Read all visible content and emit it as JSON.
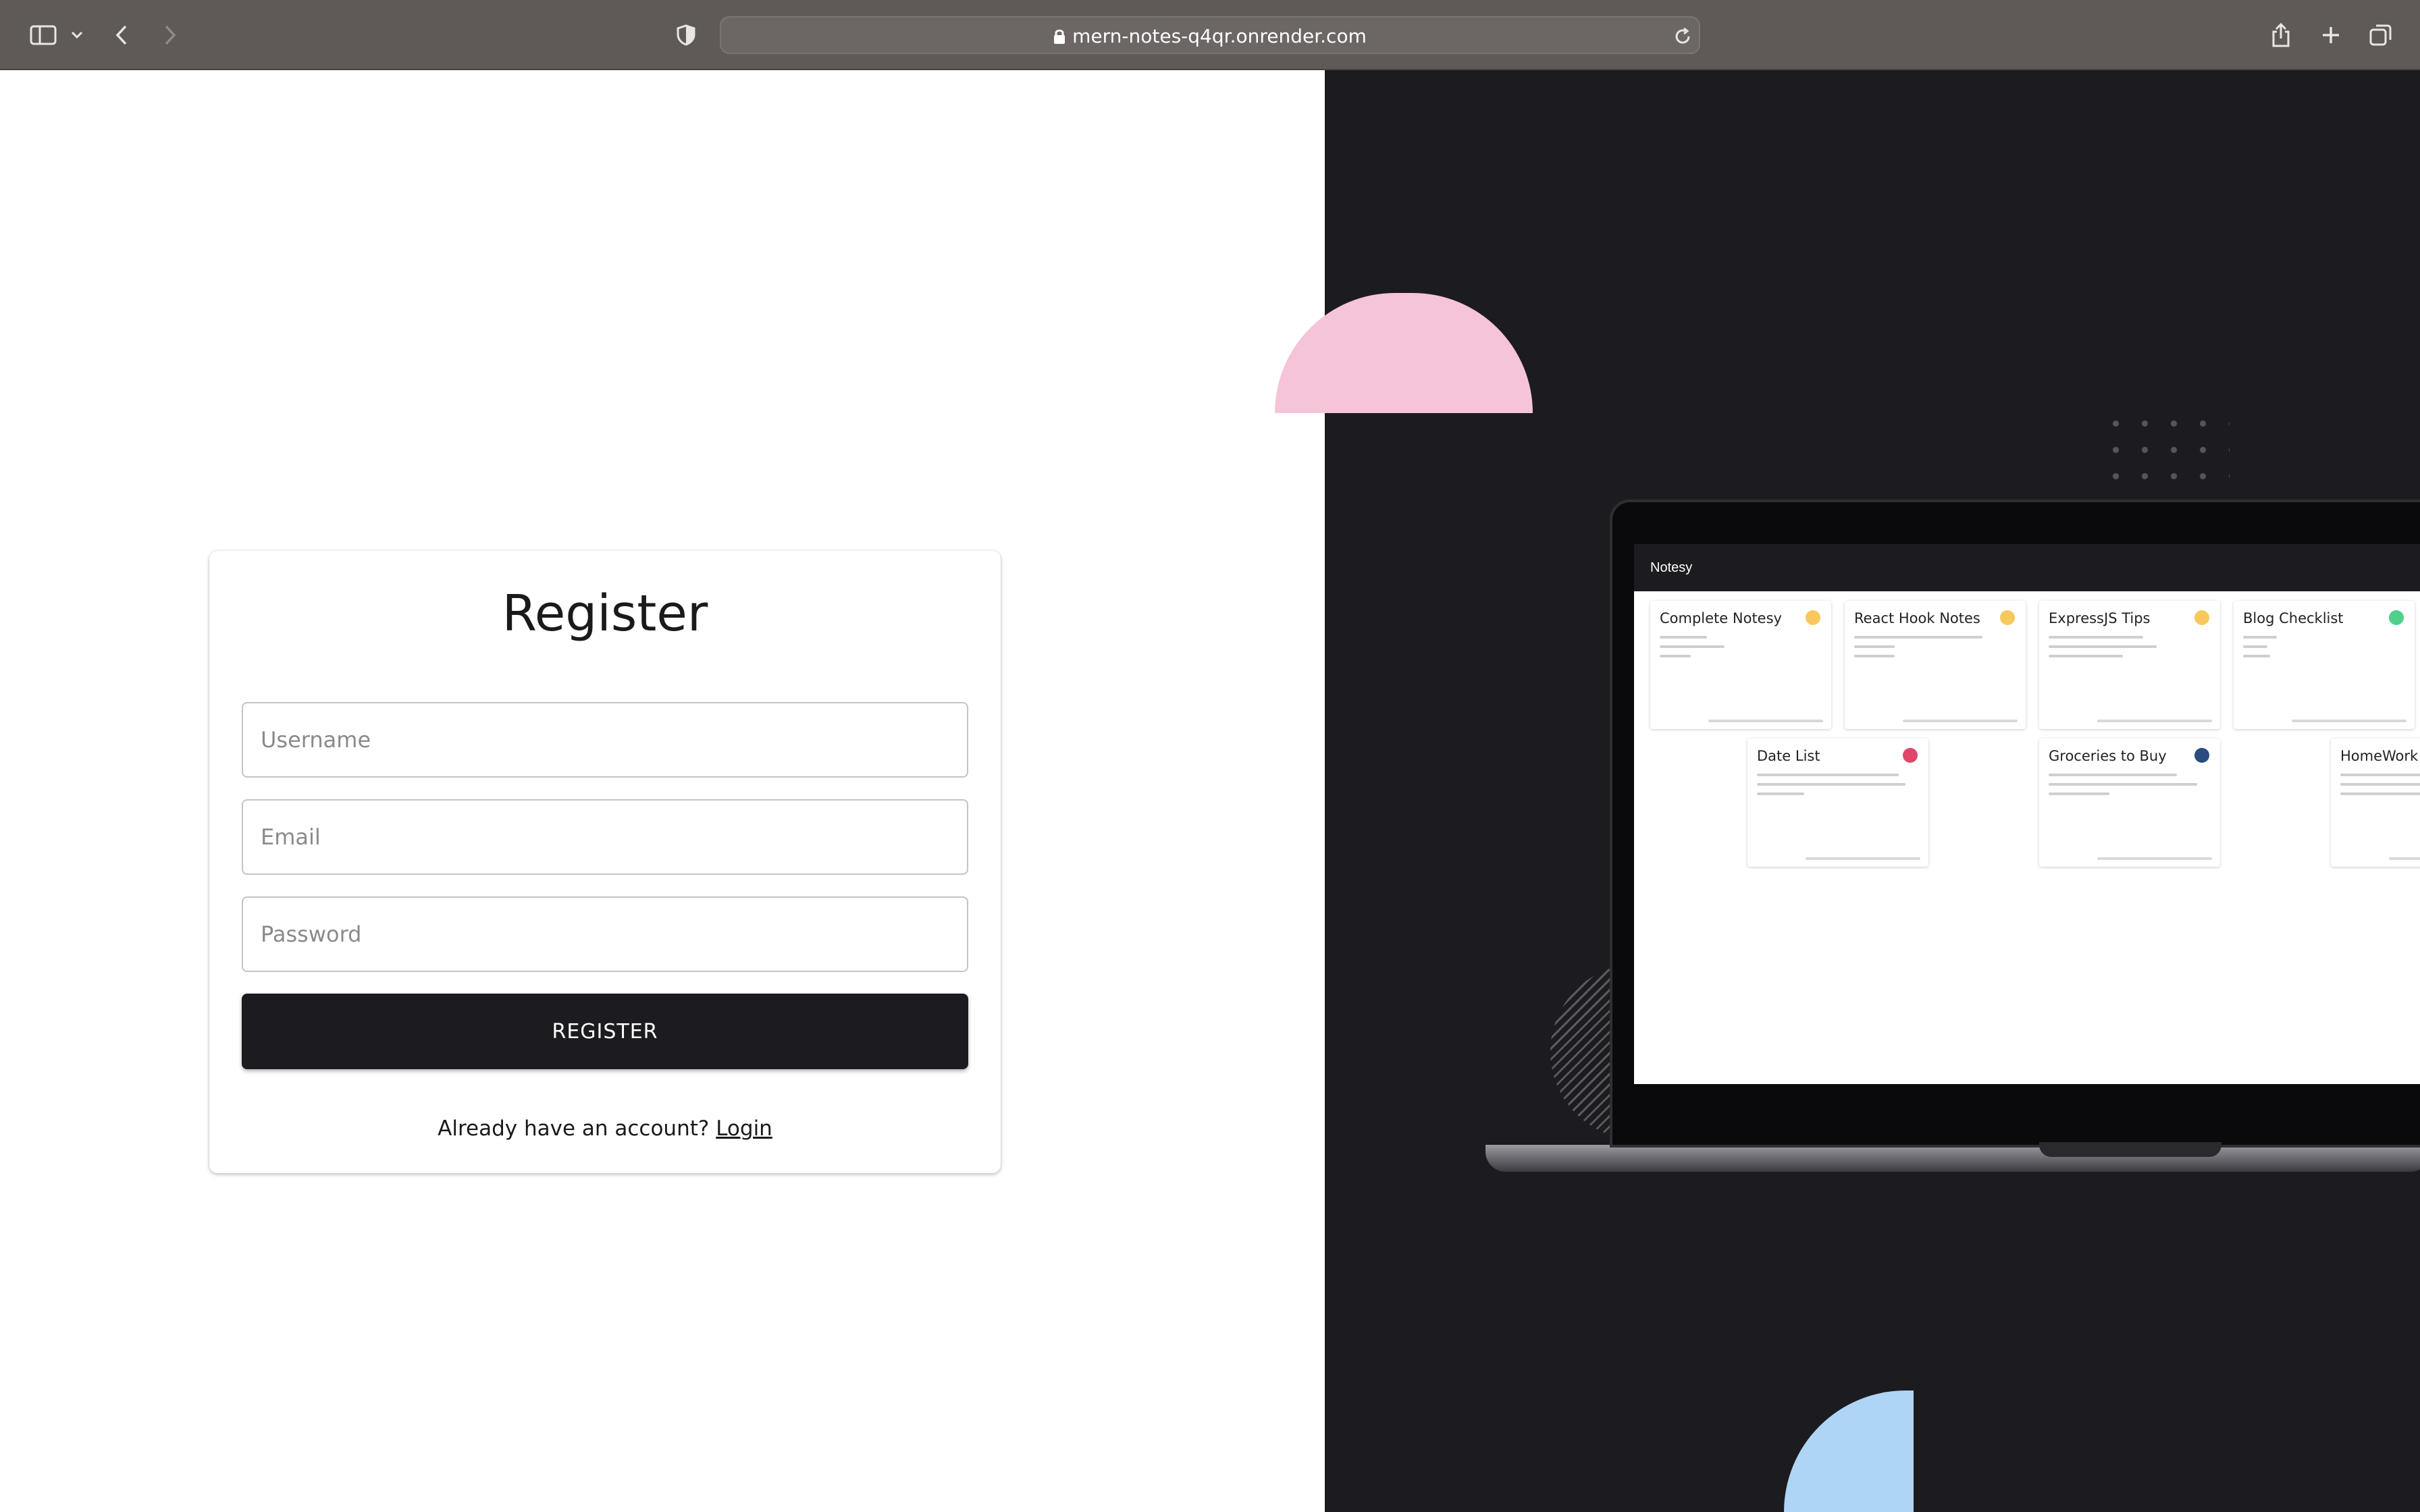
{
  "browser": {
    "url": "mern-notes-q4qr.onrender.com",
    "icons": [
      "sidebar-icon",
      "chevron-down-icon",
      "back-icon",
      "forward-icon",
      "shield-icon",
      "lock-icon",
      "reload-icon",
      "share-icon",
      "new-tab-icon",
      "tabs-overview-icon"
    ]
  },
  "register": {
    "title": "Register",
    "username_placeholder": "Username",
    "email_placeholder": "Email",
    "password_placeholder": "Password",
    "button_label": "REGISTER",
    "already_text": "Already have an account?",
    "login_link": "Login"
  },
  "preview": {
    "app_name": "Notesy",
    "notes": [
      {
        "title": "Complete Notesy",
        "color": "#f7c95c"
      },
      {
        "title": "React Hook Notes",
        "color": "#f7c95c"
      },
      {
        "title": "ExpressJS Tips",
        "color": "#f7c95c"
      },
      {
        "title": "Blog Checklist",
        "color": "#4fd18b"
      },
      {
        "title": "Date List",
        "color": "#e0466a"
      },
      {
        "title": "Groceries to Buy",
        "color": "#2a4c7e"
      },
      {
        "title": "HomeWork",
        "color": ""
      }
    ]
  },
  "colors": {
    "dark_panel": "#1b1b20",
    "pink_shape": "#f5c4d8",
    "blue_shape": "#aed5f5",
    "button_bg": "#1b1b20"
  }
}
